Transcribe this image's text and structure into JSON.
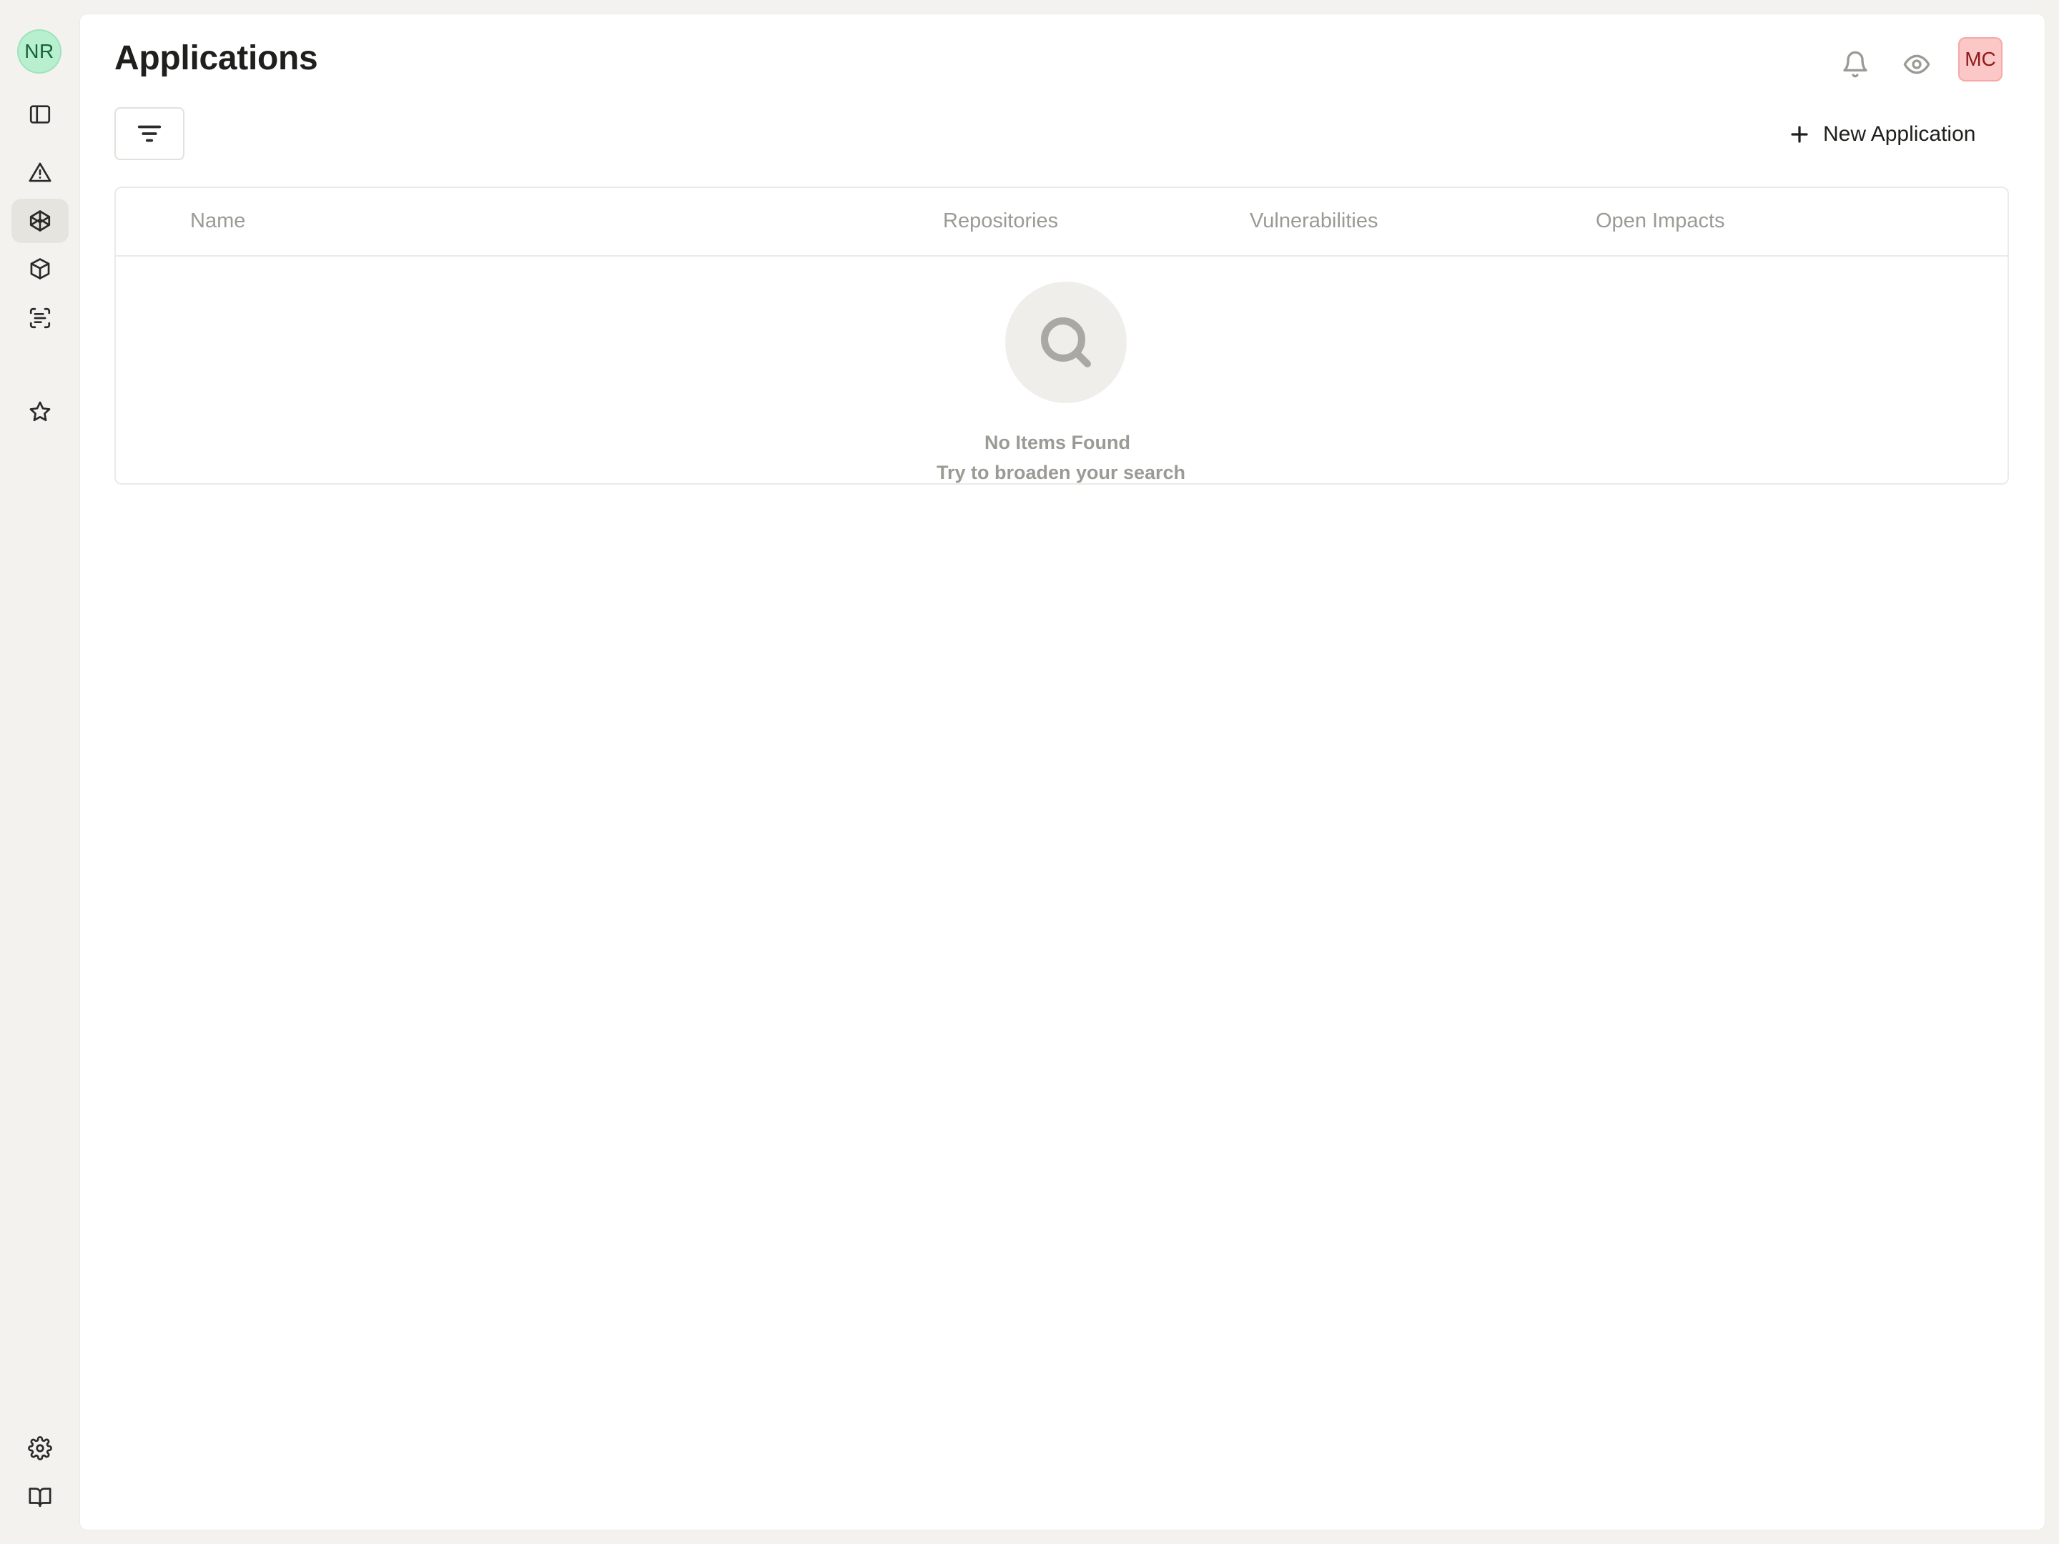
{
  "workspace": {
    "initials": "NR"
  },
  "sidebar": {
    "items": [
      {
        "icon": "panel-toggle-icon"
      },
      {
        "icon": "alert-triangle-icon"
      },
      {
        "icon": "applications-icon",
        "active": true
      },
      {
        "icon": "package-cube-icon"
      },
      {
        "icon": "scan-text-icon"
      },
      {
        "icon": "star-icon"
      },
      {
        "icon": "gear-icon"
      },
      {
        "icon": "book-open-icon"
      }
    ]
  },
  "header": {
    "title": "Applications",
    "user_initials": "MC",
    "icons": [
      "bell-icon",
      "eye-icon"
    ]
  },
  "toolbar": {
    "new_button_label": "New Application"
  },
  "table": {
    "columns": [
      "Name",
      "Repositories",
      "Vulnerabilities",
      "Open Impacts"
    ],
    "rows": []
  },
  "empty_state": {
    "title": "No Items Found",
    "subtitle": "Try to broaden your search"
  },
  "colors": {
    "workspace_avatar_bg": "#b8f0cf",
    "user_avatar_bg": "#fbc7c7",
    "active_nav_bg": "#e5e4df"
  }
}
